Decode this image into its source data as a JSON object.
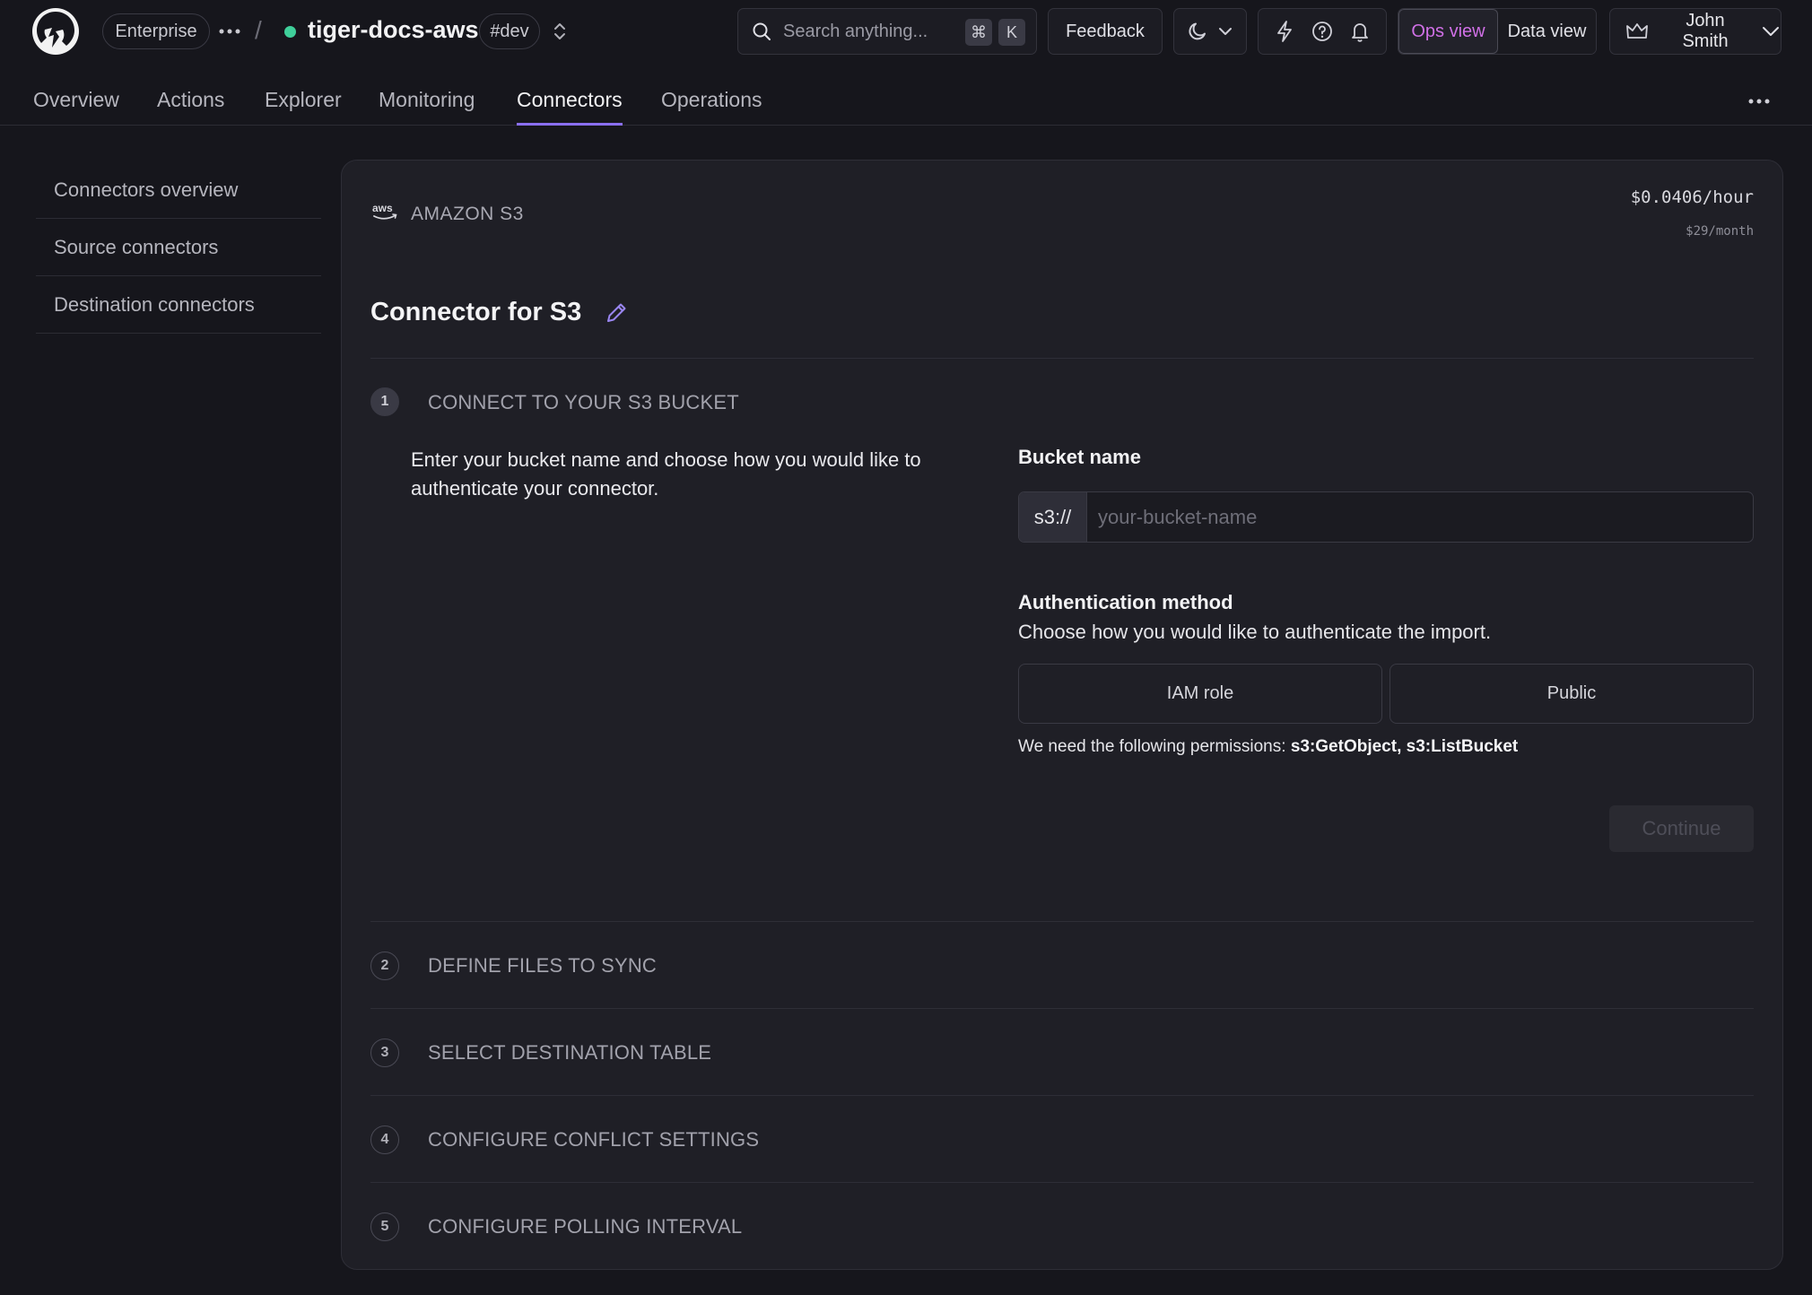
{
  "topbar": {
    "org_label": "Enterprise",
    "service_name": "tiger-docs-aws",
    "env_tag": "#dev",
    "search_placeholder": "Search anything...",
    "search_kbd_1": "⌘",
    "search_kbd_2": "K",
    "feedback_label": "Feedback",
    "views": [
      {
        "label": "Ops view",
        "active": true
      },
      {
        "label": "Data view",
        "active": false
      }
    ],
    "user_name": "John Smith"
  },
  "nav": {
    "tabs": [
      {
        "label": "Overview",
        "active": false
      },
      {
        "label": "Actions",
        "active": false
      },
      {
        "label": "Explorer",
        "active": false
      },
      {
        "label": "Monitoring",
        "active": false
      },
      {
        "label": "Connectors",
        "active": true
      },
      {
        "label": "Operations",
        "active": false
      }
    ]
  },
  "sidebar": {
    "items": [
      {
        "label": "Connectors overview"
      },
      {
        "label": "Source connectors"
      },
      {
        "label": "Destination connectors"
      }
    ]
  },
  "connector": {
    "provider": "AMAZON S3",
    "price_hour": "$0.0406/hour",
    "price_month": "$29/month",
    "title": "Connector for S3"
  },
  "steps": [
    {
      "number": "1",
      "label": "CONNECT TO YOUR S3 BUCKET",
      "active": true
    },
    {
      "number": "2",
      "label": "DEFINE FILES TO SYNC",
      "active": false
    },
    {
      "number": "3",
      "label": "SELECT DESTINATION TABLE",
      "active": false
    },
    {
      "number": "4",
      "label": "CONFIGURE CONFLICT SETTINGS",
      "active": false
    },
    {
      "number": "5",
      "label": "CONFIGURE POLLING INTERVAL",
      "active": false
    }
  ],
  "step1": {
    "description": "Enter your bucket name and choose how you would like to authenticate your connector.",
    "bucket_label": "Bucket name",
    "bucket_prefix": "s3://",
    "bucket_placeholder": "your-bucket-name",
    "bucket_value": "",
    "auth_label": "Authentication method",
    "auth_sub": "Choose how you would like to authenticate the import.",
    "auth_options": [
      "IAM role",
      "Public"
    ],
    "perm_prefix": "We need the following permissions: ",
    "perm_list": "s3:GetObject, s3:ListBucket",
    "continue_label": "Continue"
  },
  "colors": {
    "accent": "#8a6ff0",
    "ops_view": "#d070e6",
    "status_dot": "#3fcf9a",
    "background": "#16161c",
    "panel": "#1f1f26"
  },
  "icons": {
    "logo": "tiger-logo",
    "search": "search-icon",
    "theme": "moon-icon",
    "chevron": "chevron-down-icon",
    "bolt": "bolt-icon",
    "help": "help-icon",
    "bell": "bell-icon",
    "crown": "crown-icon",
    "edit": "pencil-icon",
    "more": "more-horizontal-icon",
    "service_switch": "chevron-up-down-icon",
    "provider": "aws-logo"
  }
}
